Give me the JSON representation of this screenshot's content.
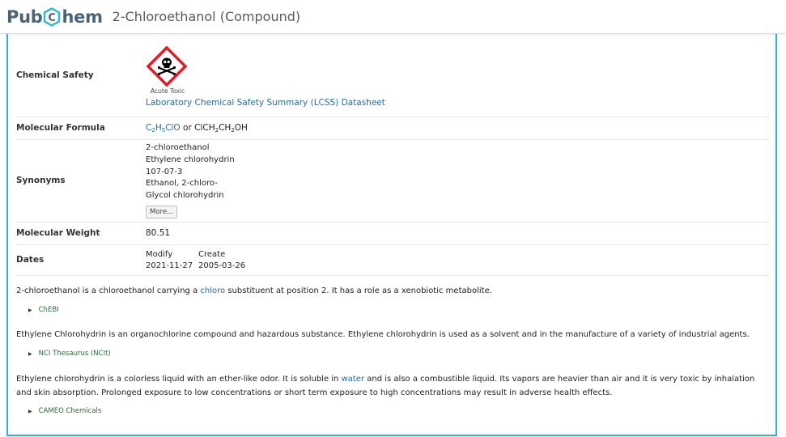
{
  "header": {
    "logo_pub": "Pub",
    "logo_c": "C",
    "logo_hem": "hem",
    "title": "2-Chloroethanol (Compound)"
  },
  "properties": {
    "chemical_safety": {
      "label": "Chemical Safety",
      "pictogram_caption": "Acute Toxic",
      "lcss_link": "Laboratory Chemical Safety Summary (LCSS) Datasheet"
    },
    "molecular_formula": {
      "label": "Molecular Formula",
      "formula_link": "C2H5ClO",
      "or_text": " or ",
      "alt_formula": "ClCH2CH2OH"
    },
    "synonyms": {
      "label": "Synonyms",
      "items": [
        "2-chloroethanol",
        "Ethylene chlorohydrin",
        "107-07-3",
        "Ethanol, 2-chloro-",
        "Glycol chlorohydrin"
      ],
      "more_label": "More..."
    },
    "molecular_weight": {
      "label": "Molecular Weight",
      "value": "80.51"
    },
    "dates": {
      "label": "Dates",
      "modify_label": "Modify",
      "create_label": "Create",
      "modify_value": "2021-11-27",
      "create_value": "2005-03-26"
    }
  },
  "descriptions": [
    {
      "text_before": "2-chloroethanol is a chloroethanol carrying a ",
      "link_text": "chloro",
      "text_after": " substituent at position 2. It has a role as a xenobiotic metabolite.",
      "source": "ChEBI"
    },
    {
      "text_before": "Ethylene Chlorohydrin is an organochlorine compound and hazardous substance. Ethylene chlorohydrin is used as a solvent and in the manufacture of a variety of industrial agents.",
      "link_text": "",
      "text_after": "",
      "source": "NCI Thesaurus (NCIt)"
    },
    {
      "text_before": "Ethylene chlorohydrin is a colorless liquid with an ether-like odor. It is soluble in ",
      "link_text": "water",
      "text_after": " and is also a combustible liquid. Its vapors are heavier than air and it is very toxic by inhalation and skin absorption. Prolonged exposure to low concentrations or short term exposure to high concentrations may result in adverse health effects.",
      "source": "CAMEO Chemicals"
    }
  ],
  "colors": {
    "brand": "#4a6478",
    "hex_accent": "#2bb6d6",
    "link": "#226d9e",
    "source_link": "#2e6a3a",
    "ghs_red": "#e31b23"
  },
  "icons": {
    "ghs_pictogram": "skull-crossbones-diamond-icon",
    "disclosure": "triangle-right-icon"
  }
}
